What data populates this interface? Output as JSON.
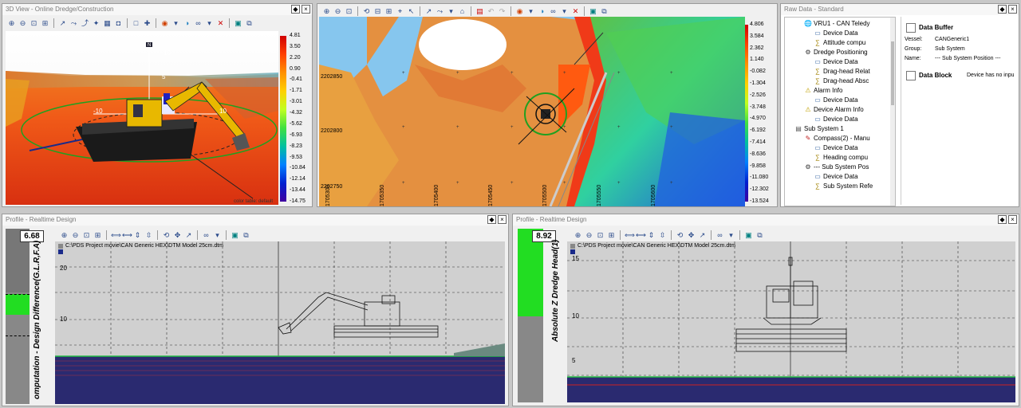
{
  "panel_3d": {
    "title": "3D View - Online Dredge/Construction",
    "scale": [
      "4.81",
      "3.50",
      "2.20",
      "0.90",
      "-0.41",
      "-1.71",
      "-3.01",
      "-4.32",
      "-5.62",
      "-6.93",
      "-8.23",
      "-9.53",
      "-10.84",
      "-12.14",
      "-13.44",
      "-14.75"
    ],
    "axis_labels": {
      "z_top": "10",
      "z_mid": "5",
      "x_left": "-10",
      "x_right": "10",
      "tag": "N"
    },
    "footer": "color table: default"
  },
  "panel_map": {
    "scale": [
      "4.806",
      "3.584",
      "2.362",
      "1.140",
      "-0.082",
      "-1.304",
      "-2.526",
      "-3.748",
      "-4.970",
      "-6.192",
      "-7.414",
      "-8.636",
      "-9.858",
      "-11.080",
      "-12.302",
      "-13.524"
    ],
    "y_labels": [
      "2202850",
      "2202800",
      "2202750"
    ],
    "x_labels": [
      "1705300",
      "1705350",
      "1705400",
      "1705450",
      "1705500",
      "1705550",
      "1705600"
    ]
  },
  "raw_data": {
    "title": "Raw Data - Standard",
    "tree": [
      {
        "indent": 2,
        "label": "VRU1 - CAN Teledy",
        "icon": "globe-icon"
      },
      {
        "indent": 3,
        "label": "Device Data",
        "icon": "doc-icon"
      },
      {
        "indent": 3,
        "label": "Attitude compu",
        "icon": "compute-icon"
      },
      {
        "indent": 2,
        "label": "Dredge Positioning",
        "icon": "gear-icon"
      },
      {
        "indent": 3,
        "label": "Device Data",
        "icon": "doc-icon"
      },
      {
        "indent": 3,
        "label": "Drag-head Relat",
        "icon": "compute-icon"
      },
      {
        "indent": 3,
        "label": "Drag-head Absc",
        "icon": "compute-icon"
      },
      {
        "indent": 2,
        "label": "Alarm Info",
        "icon": "warning-icon"
      },
      {
        "indent": 3,
        "label": "Device Data",
        "icon": "doc-icon"
      },
      {
        "indent": 2,
        "label": "Device Alarm Info",
        "icon": "warning-icon"
      },
      {
        "indent": 3,
        "label": "Device Data",
        "icon": "doc-icon"
      },
      {
        "indent": 1,
        "label": "Sub System 1",
        "icon": "system-icon"
      },
      {
        "indent": 2,
        "label": "Compass(2) - Manu",
        "icon": "compass-icon"
      },
      {
        "indent": 3,
        "label": "Device Data",
        "icon": "doc-icon"
      },
      {
        "indent": 3,
        "label": "Heading compu",
        "icon": "compute-icon"
      },
      {
        "indent": 2,
        "label": "--- Sub System Pos",
        "icon": "gear-icon"
      },
      {
        "indent": 3,
        "label": "Device Data",
        "icon": "doc-icon"
      },
      {
        "indent": 3,
        "label": "Sub System Refe",
        "icon": "compute-icon"
      }
    ],
    "buffer": {
      "title": "Data Buffer",
      "vessel_label": "Vessel:",
      "vessel_value": "CANGeneric1",
      "group_label": "Group:",
      "group_value": "Sub System",
      "name_label": "Name:",
      "name_value": "--- Sub System Position ---"
    },
    "block": {
      "title": "Data Block",
      "message": "Device has no inpu"
    }
  },
  "profile_left": {
    "title": "Profile - Realtime Design",
    "value": "6.68",
    "vertical_label": "omputation - Design Difference(G.L.R,F.A)",
    "file": "C:\\PDS Project movie\\CAN Generic HEX\\DTM Model 25cm.dtm",
    "y_ticks": [
      "20",
      "10"
    ]
  },
  "profile_right": {
    "title": "Profile - Realtime Design",
    "value": "8.92",
    "vertical_label": "Absolute Z Dredge Head(1)",
    "file": "C:\\PDS Project movie\\CAN Generic HEX\\DTM Model 25cm.dtm",
    "y_ticks": [
      "15",
      "10",
      "5"
    ]
  },
  "colors": {
    "green_bar": "#22dd22",
    "design_line": "#22bb44",
    "profile_fill": "#222266",
    "accent_red": "#cc2222"
  }
}
